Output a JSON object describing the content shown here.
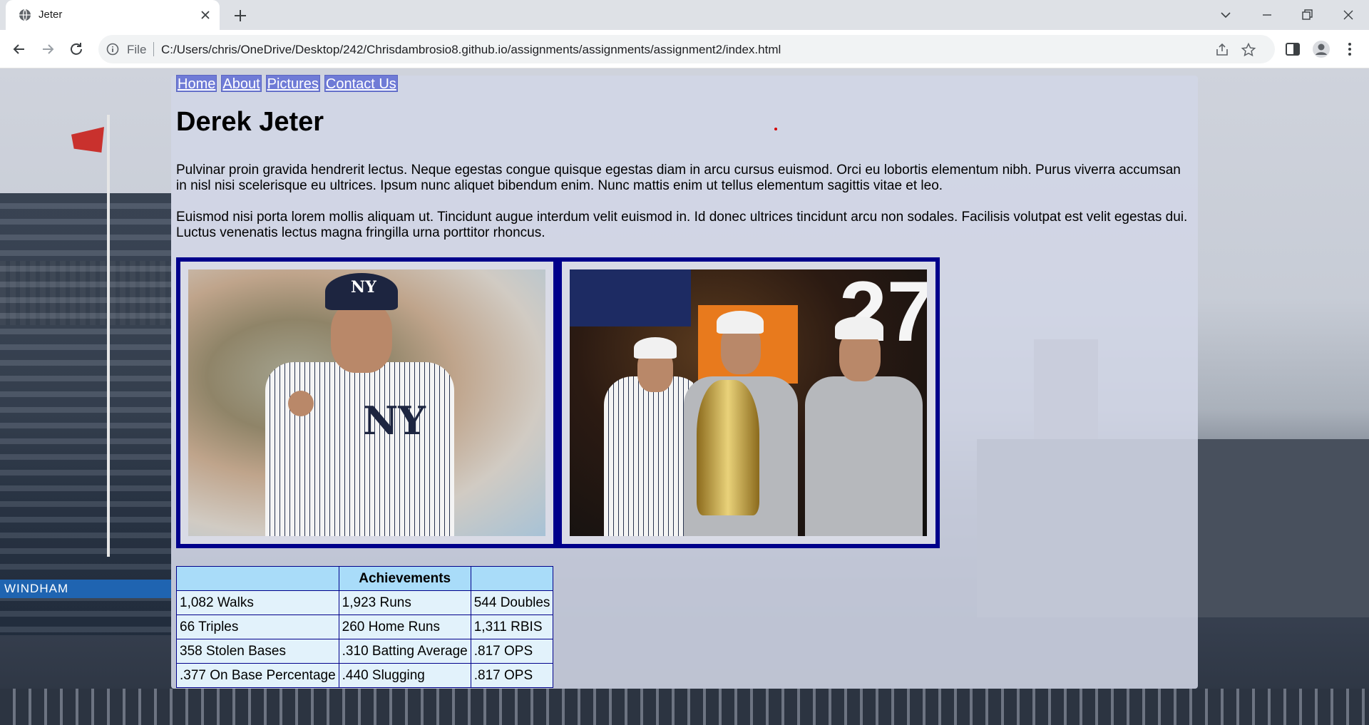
{
  "browser": {
    "tab_title": "Jeter",
    "scheme_label": "File",
    "url": "C:/Users/chris/OneDrive/Desktop/242/Chrisdambrosio8.github.io/assignments/assignments/assignment2/index.html",
    "icons": [
      "globe-icon",
      "close-icon",
      "plus-icon",
      "chevron-down-icon",
      "minimize-icon",
      "restore-icon",
      "close-window-icon",
      "back-icon",
      "forward-icon",
      "reload-icon",
      "info-icon",
      "share-icon",
      "star-icon",
      "sidepanel-icon",
      "profile-icon",
      "menu-icon"
    ]
  },
  "site": {
    "nav": [
      {
        "label": "Home"
      },
      {
        "label": "About"
      },
      {
        "label": "Pictures"
      },
      {
        "label": "Contact Us"
      }
    ],
    "title": "Derek Jeter",
    "paragraphs": [
      "Pulvinar proin gravida hendrerit lectus. Neque egestas congue quisque egestas diam in arcu cursus euismod. Orci eu lobortis elementum nibh. Purus viverra accumsan in nisl nisi scelerisque eu ultrices. Ipsum nunc aliquet bibendum enim. Nunc mattis enim ut tellus elementum sagittis vitae et leo.",
      "Euismod nisi porta lorem mollis aliquam ut. Tincidunt augue interdum velit euismod in. Id donec ultrices tincidunt arcu non sodales. Facilisis volutpat est velit egestas dui. Luctus venenatis lectus magna fringilla urna porttitor rhoncus."
    ],
    "photos": [
      {
        "name": "jeter-portrait-photo",
        "cap_logo": "NY"
      },
      {
        "name": "world-series-celebration-photo",
        "banner_number": "27"
      }
    ],
    "table": {
      "headers": [
        "",
        "Achievements",
        ""
      ],
      "rows": [
        [
          "1,082 Walks",
          "1,923 Runs",
          "544 Doubles"
        ],
        [
          "66 Triples",
          "260 Home Runs",
          "1,311 RBIS"
        ],
        [
          "358 Stolen Bases",
          ".310 Batting Average",
          ".817 OPS"
        ],
        [
          ".377 On Base Percentage",
          ".440 Slugging",
          ".817 OPS"
        ]
      ]
    },
    "background_text": {
      "sign": "WINDHAM"
    },
    "colors": {
      "nav_bg": "#6f7bd6",
      "photo_border": "#00008b",
      "table_header_bg": "#a9dcf9",
      "table_cell_bg": "#e2f2fb"
    }
  }
}
